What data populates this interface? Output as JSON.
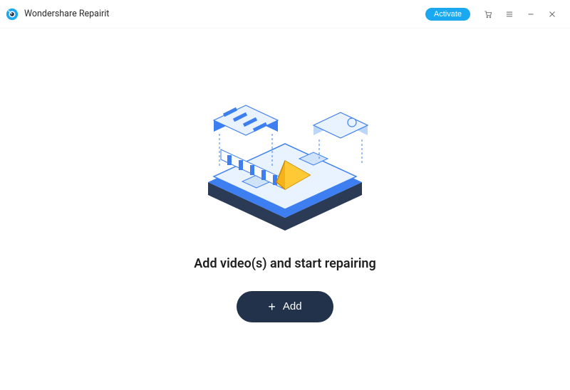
{
  "titlebar": {
    "app_name": "Wondershare Repairit",
    "activate_label": "Activate"
  },
  "main": {
    "heading": "Add video(s) and start repairing",
    "add_button_label": "Add"
  },
  "icons": {
    "app": "repairit-logo",
    "cart": "cart-icon",
    "menu": "menu-icon",
    "minimize": "minimize-icon",
    "close": "close-icon",
    "plus": "plus-icon"
  },
  "colors": {
    "accent": "#1aa8f0",
    "button_dark": "#22324a",
    "illustration_blue": "#3d7ff0",
    "illustration_light": "#cfe3fb",
    "illustration_yellow": "#f5b21a"
  }
}
